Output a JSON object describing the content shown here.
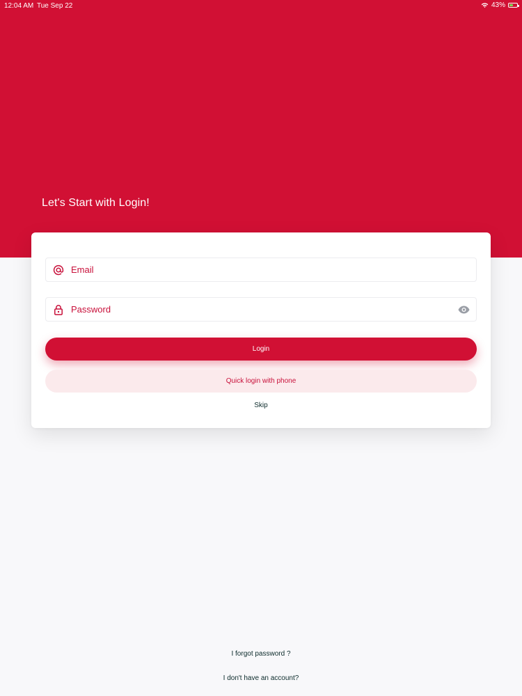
{
  "status_bar": {
    "time": "12:04 AM",
    "date": "Tue Sep 22",
    "battery": "43%",
    "battery_level": 0.43
  },
  "hero": {
    "title": "Let's Start with Login!"
  },
  "form": {
    "email_placeholder": "Email",
    "password_placeholder": "Password",
    "login_label": "Login",
    "quick_login_label": "Quick login with phone",
    "skip_label": "Skip"
  },
  "footer": {
    "forgot_password": "I forgot password ?",
    "no_account": "I don't have an account?"
  },
  "colors": {
    "brand": "#d11034",
    "brand_light": "#fbeaec",
    "background": "#f8f8fa"
  },
  "icons": {
    "email": "at-icon",
    "password": "lock-icon",
    "toggle": "eye-icon"
  }
}
